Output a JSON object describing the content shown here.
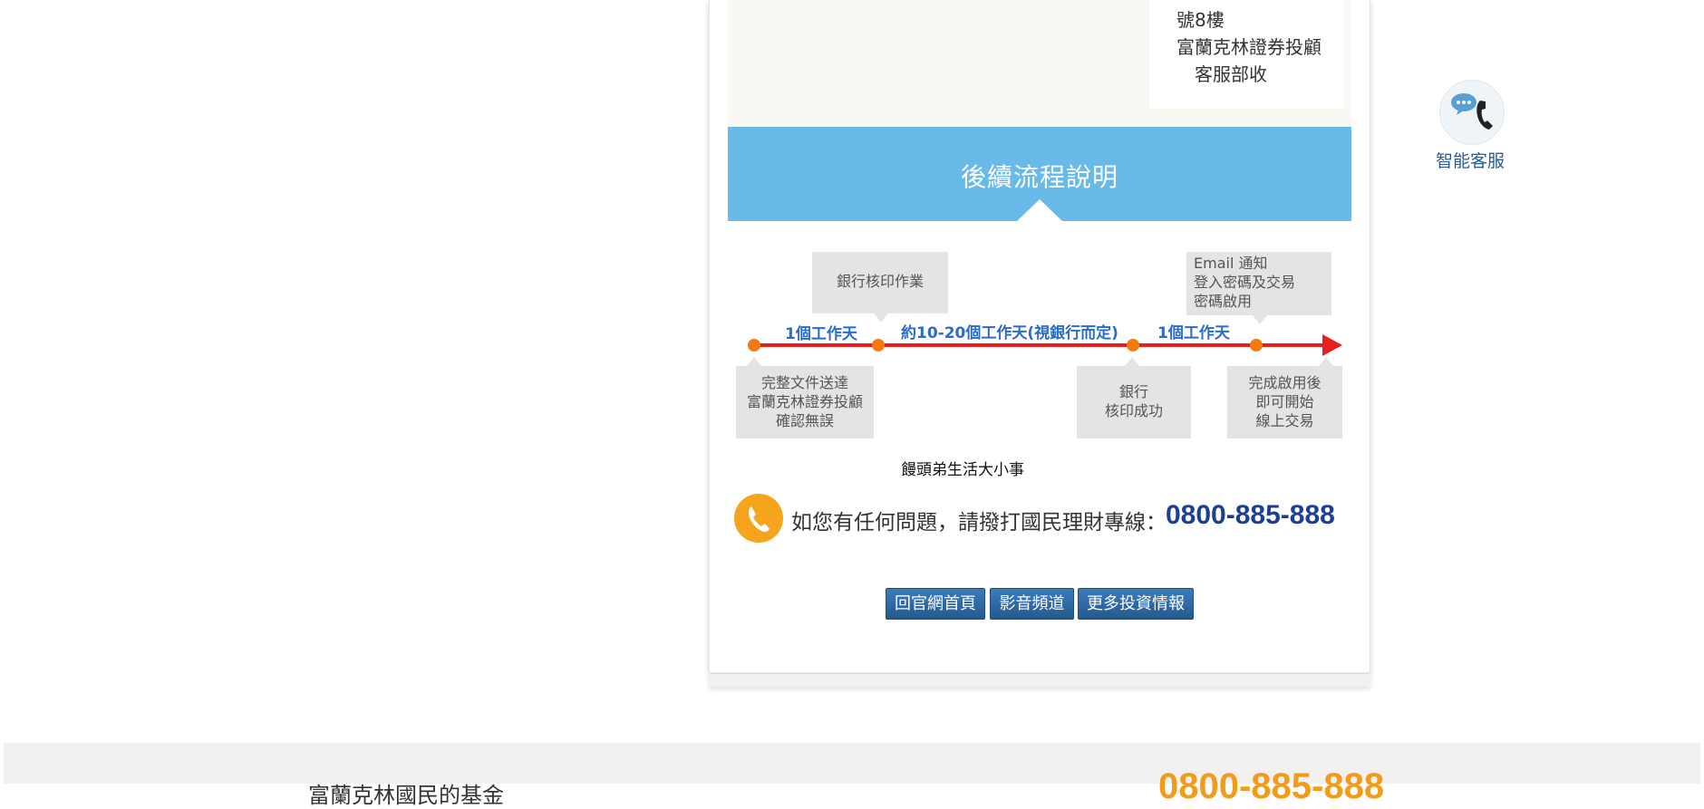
{
  "address": {
    "line1": "號8樓",
    "line2": "富蘭克林證券投顧",
    "line3": "客服部收"
  },
  "banner": {
    "title": "後續流程說明"
  },
  "flow": {
    "top_boxes": [
      {
        "lines": [
          "銀行核印作業"
        ]
      },
      {
        "lines": [
          "Email 通知",
          "登入密碼及交易",
          "密碼啟用"
        ]
      }
    ],
    "bottom_boxes": [
      {
        "lines": [
          "完整文件送達",
          "富蘭克林證券投顧",
          "確認無誤"
        ]
      },
      {
        "lines": [
          "銀行",
          "核印成功"
        ]
      },
      {
        "lines": [
          "完成啟用後",
          "即可開始",
          "線上交易"
        ]
      }
    ],
    "durations": [
      "1個工作天",
      "約10-20個工作天(視銀行而定)",
      "1個工作天"
    ]
  },
  "note": "饅頭弟生活大小事",
  "hotline": {
    "text": "如您有任何問題，請撥打國民理財專線：",
    "number": "0800-885-888"
  },
  "buttons": {
    "home": "回官網首頁",
    "video": "影音頻道",
    "more": "更多投資情報"
  },
  "chat": {
    "label": "智能客服"
  },
  "footer": {
    "number": "0800-885-888",
    "text": "富蘭克林國民的基金"
  },
  "colors": {
    "banner": "#69b9e9",
    "flow_line": "#e8201d",
    "flow_dot": "#f47a0f",
    "duration_text": "#2b6cc9",
    "hotline_number": "#1c3f94",
    "button": "#2e6ca8",
    "footer_number": "#f29b18"
  },
  "icons": {
    "phone": "phone-icon",
    "chat": "chat-phone-icon"
  }
}
